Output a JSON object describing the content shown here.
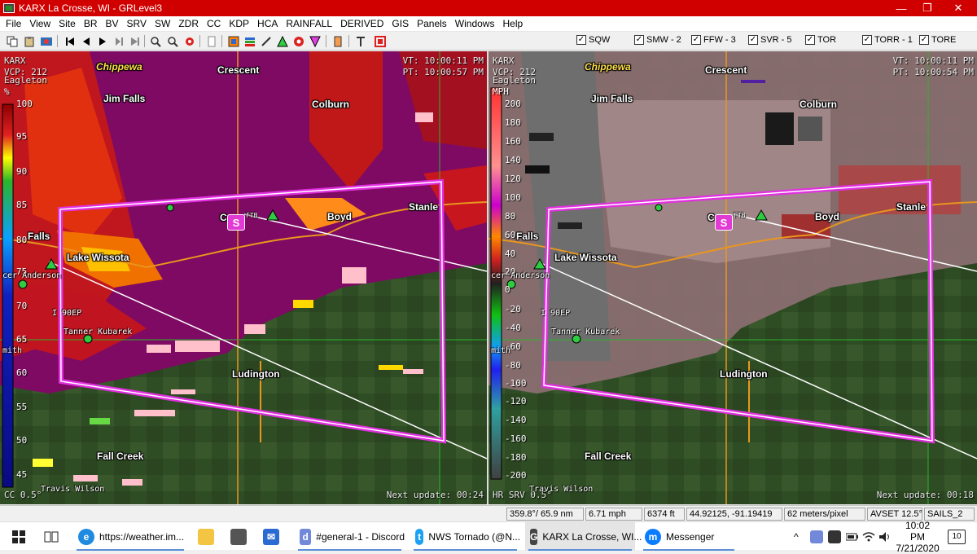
{
  "window": {
    "title": "KARX La Crosse, WI - GRLevel3",
    "controls": {
      "minimize": "—",
      "maximize": "❐",
      "close": "✕"
    }
  },
  "menu": [
    "File",
    "View",
    "Site",
    "BR",
    "BV",
    "SRV",
    "SW",
    "ZDR",
    "CC",
    "KDP",
    "HCA",
    "RAINFALL",
    "DERIVED",
    "GIS",
    "Panels",
    "Windows",
    "Help"
  ],
  "warnings": [
    {
      "label": "SQW",
      "checked": true
    },
    {
      "label": "SMW - 2",
      "checked": true
    },
    {
      "label": "FFW - 3",
      "checked": true
    },
    {
      "label": "SVR - 5",
      "checked": true
    },
    {
      "label": "TOR",
      "checked": true
    },
    {
      "label": "TORR - 1",
      "checked": true
    },
    {
      "label": "TORE",
      "checked": true
    }
  ],
  "left_panel": {
    "site": "KARX",
    "vcp": "VCP: 212",
    "place_top": "Eagleton",
    "unit": "%",
    "vt": "VT: 10:00:11 PM",
    "pt": "PT: 10:00:57 PM",
    "product": "CC 0.5°",
    "next_update": "Next update: 00:24",
    "scale": [
      "100",
      "95",
      "90",
      "85",
      "80",
      "75",
      "70",
      "65",
      "60",
      "55",
      "50",
      "45"
    ],
    "side_labels": {
      "falls": "Falls",
      "anderson": "cer Anderson",
      "smith": "mith",
      "e": "e"
    }
  },
  "right_panel": {
    "site": "KARX",
    "vcp": "VCP: 212",
    "place_top": "Eagleton",
    "unit": "MPH",
    "vt": "VT: 10:00:11 PM",
    "pt": "PT: 10:00:54 PM",
    "product": "HR SRV 0.5°",
    "next_update": "Next update: 00:18",
    "scale": [
      "200",
      "180",
      "160",
      "140",
      "120",
      "100",
      "80",
      "60",
      "40",
      "20",
      "0",
      "-20",
      "-40",
      "-60",
      "-80",
      "-100",
      "-120",
      "-140",
      "-160",
      "-180",
      "-200"
    ],
    "side_labels": {
      "falls": "Falls",
      "anderson": "cer Anderson",
      "smith": "mith",
      "e": "e"
    }
  },
  "map_labels": {
    "cities_white": [
      "Crescent",
      "Jim Falls",
      "Colburn",
      "Boyd",
      "Stanle",
      "Lake Wissota",
      "Ludington",
      "Fall Creek",
      "Cornell"
    ],
    "city_yellow": "Chippewa",
    "cadott_short": "C",
    "ftb": "FTB",
    "spotters": [
      "Tanner Kubarek",
      "Travis Wilson",
      "I 90EP"
    ]
  },
  "status": {
    "azimuth": "359.8°/ 65.9 nm",
    "velocity": "6.71 mph",
    "height": "6374 ft",
    "latlon": "44.92125, -91.19419",
    "resolution": "62 meters/pixel",
    "avset": "AVSET 12.5°",
    "sails": "SAILS_2"
  },
  "taskbar": {
    "items": [
      {
        "label": "https://weather.im...",
        "icon": "edge-browser-icon",
        "color": "#1f8be0"
      },
      {
        "label": "#general-1 - Discord",
        "icon": "discord-icon",
        "color": "#7289da"
      },
      {
        "label": "NWS Tornado (@N...",
        "icon": "twitter-icon",
        "color": "#1da1f2"
      },
      {
        "label": "KARX La Crosse, WI...",
        "icon": "grlevel3-icon",
        "color": "#444444"
      },
      {
        "label": "Messenger",
        "icon": "messenger-icon",
        "color": "#0a7cff"
      }
    ],
    "time": "10:02 PM",
    "date": "7/21/2020",
    "notifications": "10"
  },
  "colors": {
    "titlebar": "#d10000",
    "warning_polygon": "#e22fe0",
    "road": "#e8961e"
  }
}
